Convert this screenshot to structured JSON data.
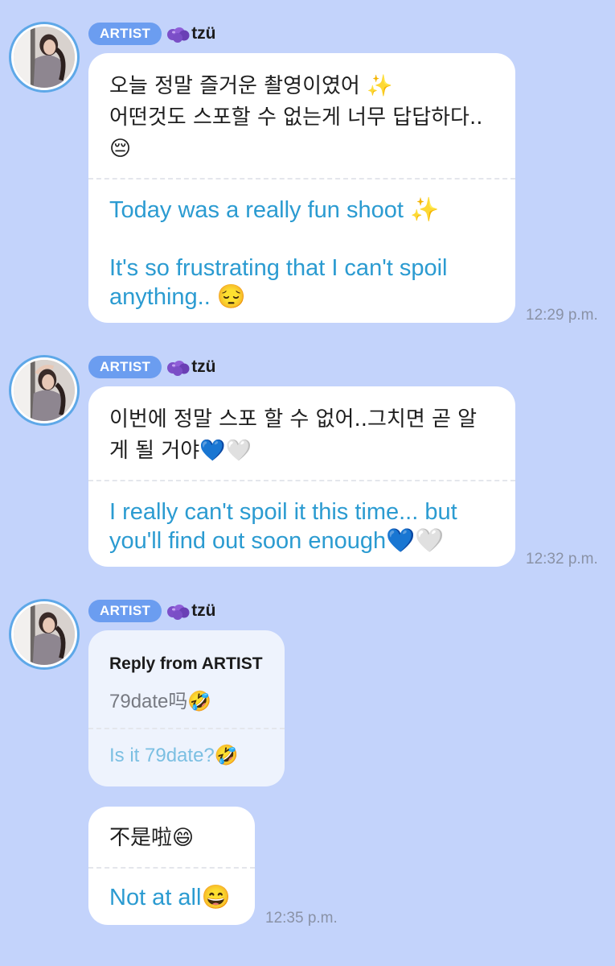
{
  "messages": [
    {
      "badge": "ARTIST",
      "name": "tzü",
      "original": "오늘 정말 즐거운 촬영이였어 ✨\n어떤것도 스포할 수 없는게 너무 답답하다..😔",
      "translation": "Today was a really fun shoot ✨\n\nIt's so frustrating that I can't spoil anything.. 😔",
      "time": "12:29 p.m."
    },
    {
      "badge": "ARTIST",
      "name": "tzü",
      "original": "이번에 정말 스포 할 수 없어..그치면 곧 알게 될 거야💙🤍",
      "translation": "I really can't spoil it this time... but you'll find out soon enough💙🤍",
      "time": "12:32 p.m."
    },
    {
      "badge": "ARTIST",
      "name": "tzü",
      "reply": {
        "title": "Reply from ARTIST",
        "original": "79date吗🤣",
        "translation": "Is it 79date?🤣"
      },
      "original": "不是啦😄",
      "translation": "Not at all😄",
      "time": "12:35 p.m."
    }
  ],
  "name_icon": "grape-purple-icon",
  "colors": {
    "background": "#c3d3fb",
    "badge": "#6b9df0",
    "translation_text": "#2b9bd1",
    "reply_background": "#eef3fd",
    "avatar_ring": "#5ea8e8"
  }
}
